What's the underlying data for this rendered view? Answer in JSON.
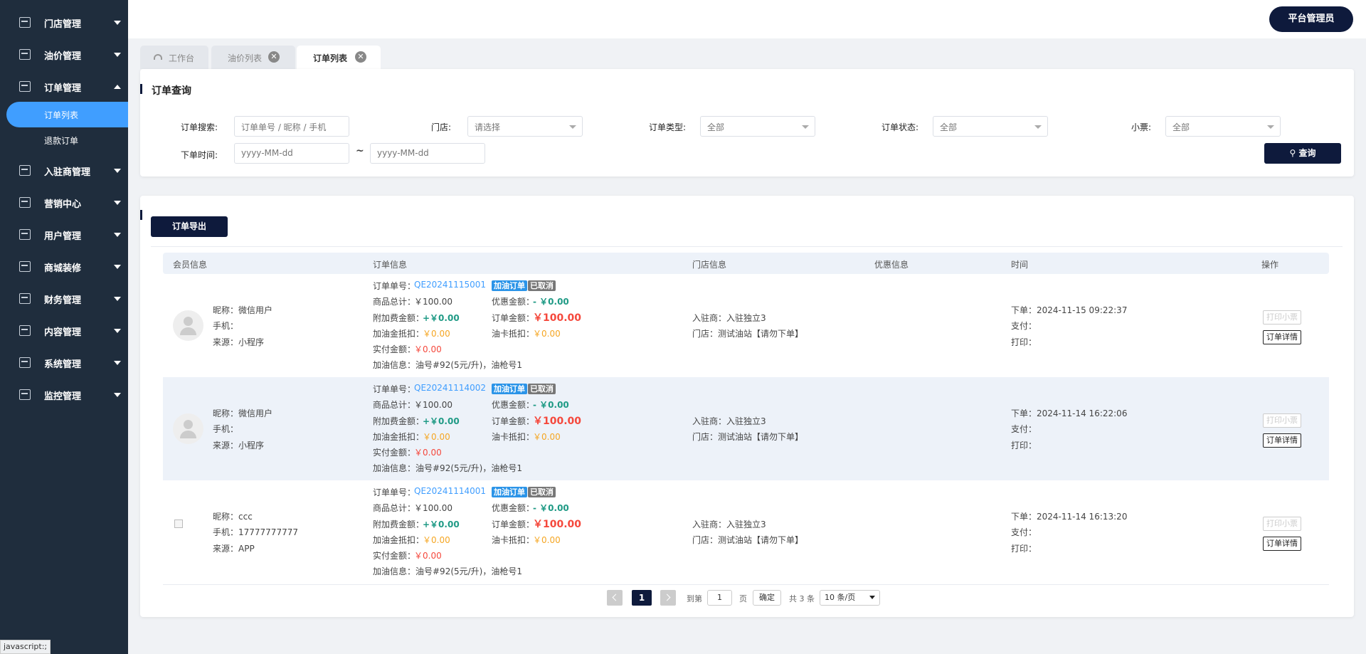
{
  "sidebar": {
    "items": [
      {
        "label": "门店管理"
      },
      {
        "label": "油价管理"
      },
      {
        "label": "订单管理"
      },
      {
        "label": "入驻商管理"
      },
      {
        "label": "营销中心"
      },
      {
        "label": "用户管理"
      },
      {
        "label": "商城装修"
      },
      {
        "label": "财务管理"
      },
      {
        "label": "内容管理"
      },
      {
        "label": "系统管理"
      },
      {
        "label": "监控管理"
      }
    ],
    "sub_items": [
      {
        "label": "订单列表",
        "active": true
      },
      {
        "label": "退款订单",
        "active": false
      }
    ],
    "colors": {
      "background": "#1f2d3d",
      "active": "#409eff"
    }
  },
  "header": {
    "admin_label": "平台管理员"
  },
  "tabs": [
    {
      "label": "工作台",
      "icon": "gauge-icon"
    },
    {
      "label": "油价列表",
      "close": "✕"
    },
    {
      "label": "订单列表",
      "close": "✕",
      "active": true
    }
  ],
  "query": {
    "title": "订单查询",
    "search_label": "订单搜索:",
    "search_placeholder": "订单单号 / 昵称 / 手机",
    "store_label": "门店:",
    "store_value": "请选择",
    "type_label": "订单类型:",
    "type_value": "全部",
    "status_label": "订单状态:",
    "status_value": "全部",
    "ticket_label": "小票:",
    "ticket_value": "全部",
    "time_label": "下单时间:",
    "start_placeholder": "yyyy-MM-dd",
    "range_sep": "~",
    "end_placeholder": "yyyy-MM-dd",
    "query_button": "查询"
  },
  "list": {
    "export_button": "订单导出",
    "headers": [
      "会员信息",
      "订单信息",
      "门店信息",
      "优惠信息",
      "时间",
      "操作"
    ],
    "rows": [
      {
        "nickname": "昵称：微信用户",
        "phone": "手机：",
        "source": "来源：小程序",
        "order_no_label": "订单单号：",
        "order_no": "QE20241115001",
        "badge_type": "加油订单",
        "badge_status": "已取消",
        "goods_total_label": "商品总计：",
        "goods_total": "￥100.00",
        "discount_label": "优惠金额：",
        "discount": "- ￥0.00",
        "extra_fee_label": "附加费金额：",
        "extra_fee": "+￥0.00",
        "order_amount_label": "订单金额：",
        "order_amount": "￥100.00",
        "fuel_deduct_label": "加油金抵扣：",
        "fuel_deduct": "￥0.00",
        "card_deduct_label": "油卡抵扣：",
        "card_deduct": "￥0.00",
        "paid_label": "实付金额：",
        "paid": "￥0.00",
        "fuel_info": "加油信息：油号#92(5元/升)，油枪号1",
        "merchant": "入驻商：入驻独立3",
        "store": "门店：测试油站【请勿下单】",
        "order_time": "下单：2024-11-15 09:22:37",
        "pay_time": "支付：",
        "print_time": "打印：",
        "print_button": "打印小票",
        "detail_button": "订单详情",
        "avatar": "avatar-icon"
      },
      {
        "nickname": "昵称：微信用户",
        "phone": "手机：",
        "source": "来源：小程序",
        "order_no_label": "订单单号：",
        "order_no": "QE20241114002",
        "badge_type": "加油订单",
        "badge_status": "已取消",
        "goods_total_label": "商品总计：",
        "goods_total": "￥100.00",
        "discount_label": "优惠金额：",
        "discount": "- ￥0.00",
        "extra_fee_label": "附加费金额：",
        "extra_fee": "+￥0.00",
        "order_amount_label": "订单金额：",
        "order_amount": "￥100.00",
        "fuel_deduct_label": "加油金抵扣：",
        "fuel_deduct": "￥0.00",
        "card_deduct_label": "油卡抵扣：",
        "card_deduct": "￥0.00",
        "paid_label": "实付金额：",
        "paid": "￥0.00",
        "fuel_info": "加油信息：油号#92(5元/升)，油枪号1",
        "merchant": "入驻商：入驻独立3",
        "store": "门店：测试油站【请勿下单】",
        "order_time": "下单：2024-11-14 16:22:06",
        "pay_time": "支付：",
        "print_time": "打印：",
        "print_button": "打印小票",
        "detail_button": "订单详情",
        "avatar": "avatar-icon"
      },
      {
        "nickname": "昵称：ccc",
        "phone": "手机：17777777777",
        "source": "来源：APP",
        "order_no_label": "订单单号：",
        "order_no": "QE20241114001",
        "badge_type": "加油订单",
        "badge_status": "已取消",
        "goods_total_label": "商品总计：",
        "goods_total": "￥100.00",
        "discount_label": "优惠金额：",
        "discount": "- ￥0.00",
        "extra_fee_label": "附加费金额：",
        "extra_fee": "+￥0.00",
        "order_amount_label": "订单金额：",
        "order_amount": "￥100.00",
        "fuel_deduct_label": "加油金抵扣：",
        "fuel_deduct": "￥0.00",
        "card_deduct_label": "油卡抵扣：",
        "card_deduct": "￥0.00",
        "paid_label": "实付金额：",
        "paid": "￥0.00",
        "fuel_info": "加油信息：油号#92(5元/升)，油枪号1",
        "merchant": "入驻商：入驻独立3",
        "store": "门店：测试油站【请勿下单】",
        "order_time": "下单：2024-11-14 16:13:20",
        "pay_time": "支付：",
        "print_time": "打印：",
        "print_button": "打印小票",
        "detail_button": "订单详情",
        "avatar": "broken-image-icon"
      }
    ]
  },
  "pagination": {
    "current": "1",
    "goto_label": "到第",
    "goto_value": "1",
    "page_unit": "页",
    "confirm": "确定",
    "total": "共 3 条",
    "page_size": "10 条/页"
  },
  "status_bar": {
    "text": "javascript:;"
  }
}
